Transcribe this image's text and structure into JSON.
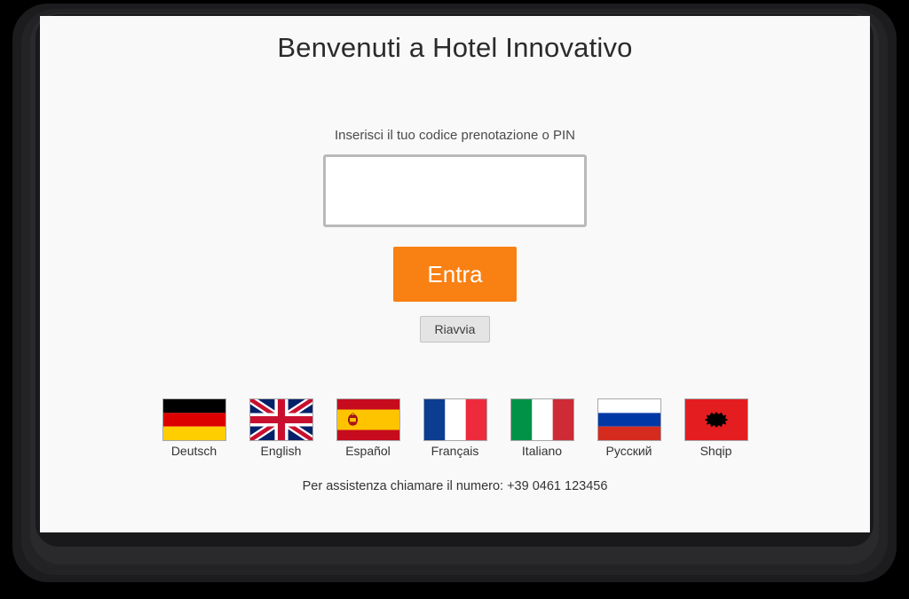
{
  "screen": {
    "title": "Benvenuti a Hotel Innovativo",
    "prompt_label": "Inserisci il tuo codice prenotazione o PIN",
    "code_input": {
      "value": "",
      "placeholder": ""
    },
    "enter_button_label": "Entra",
    "restart_button_label": "Riavvia",
    "support_text": "Per assistenza chiamare il numero: +39 0461 123456"
  },
  "languages": [
    {
      "label": "Deutsch",
      "flag": "de-flag-icon"
    },
    {
      "label": "English",
      "flag": "gb-flag-icon"
    },
    {
      "label": "Español",
      "flag": "es-flag-icon"
    },
    {
      "label": "Français",
      "flag": "fr-flag-icon"
    },
    {
      "label": "Italiano",
      "flag": "it-flag-icon"
    },
    {
      "label": "Русский",
      "flag": "ru-flag-icon"
    },
    {
      "label": "Shqip",
      "flag": "al-flag-icon"
    }
  ],
  "colors": {
    "accent_orange": "#f98012",
    "screen_background": "#f9f9f9",
    "bezel_black": "#1c1c1e",
    "input_border": "#b9b9b9",
    "restart_button_background": "#e4e4e4"
  }
}
